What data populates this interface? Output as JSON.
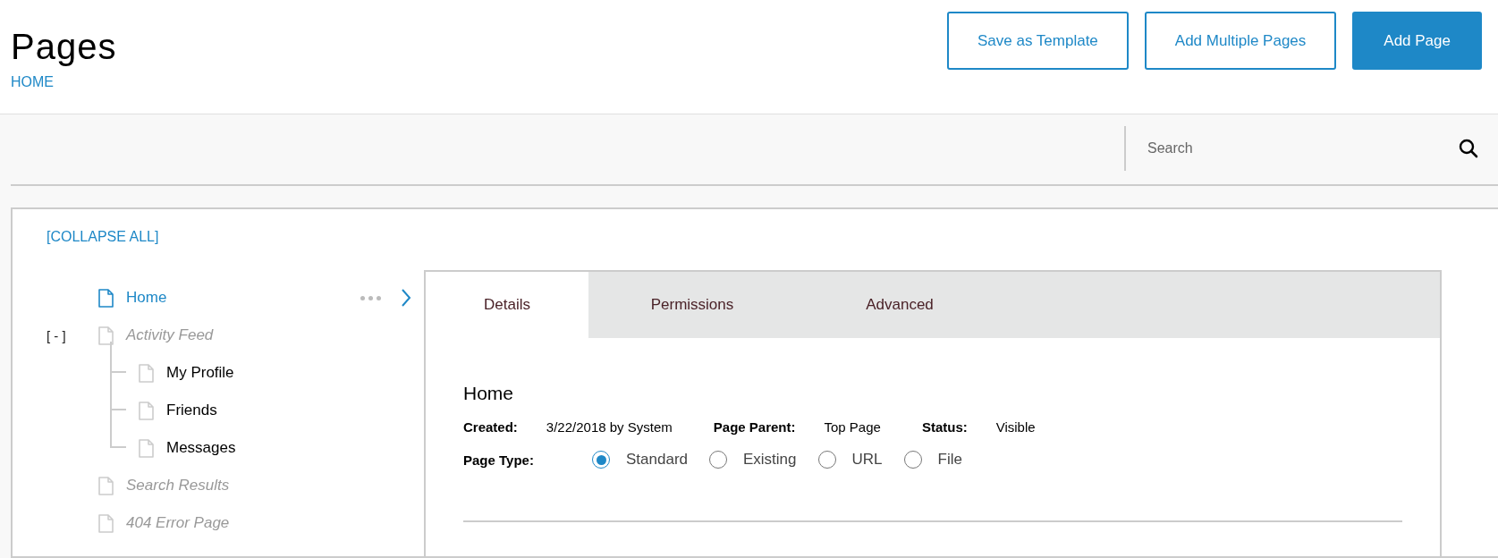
{
  "header": {
    "title": "Pages",
    "breadcrumb": "HOME",
    "buttons": [
      {
        "label": "Save as Template",
        "kind": "outline"
      },
      {
        "label": "Add Multiple Pages",
        "kind": "outline"
      },
      {
        "label": "Add Page",
        "kind": "primary"
      }
    ]
  },
  "search": {
    "placeholder": "Search"
  },
  "tree": {
    "collapse_all": "[COLLAPSE ALL]",
    "items": [
      {
        "label": "Home",
        "selected": true,
        "hidden": false
      },
      {
        "label": "Activity Feed",
        "selected": false,
        "hidden": true,
        "expanded": true,
        "toggle": "[ - ]",
        "children": [
          {
            "label": "My Profile",
            "selected": false,
            "hidden": false
          },
          {
            "label": "Friends",
            "selected": false,
            "hidden": false
          },
          {
            "label": "Messages",
            "selected": false,
            "hidden": false
          }
        ]
      },
      {
        "label": "Search Results",
        "selected": false,
        "hidden": true
      },
      {
        "label": "404 Error Page",
        "selected": false,
        "hidden": true
      }
    ]
  },
  "details": {
    "tabs": [
      {
        "label": "Details",
        "selected": true
      },
      {
        "label": "Permissions",
        "selected": false
      },
      {
        "label": "Advanced",
        "selected": false
      }
    ],
    "heading": "Home",
    "fields": [
      {
        "label": "Created:",
        "value": "3/22/2018 by System"
      },
      {
        "label": "Page Parent:",
        "value": "Top Page"
      },
      {
        "label": "Status:",
        "value": "Visible"
      }
    ],
    "page_type": {
      "label": "Page Type:",
      "options": [
        {
          "label": "Standard",
          "selected": true
        },
        {
          "label": "Existing",
          "selected": false
        },
        {
          "label": "URL",
          "selected": false
        },
        {
          "label": "File",
          "selected": false
        }
      ]
    }
  }
}
